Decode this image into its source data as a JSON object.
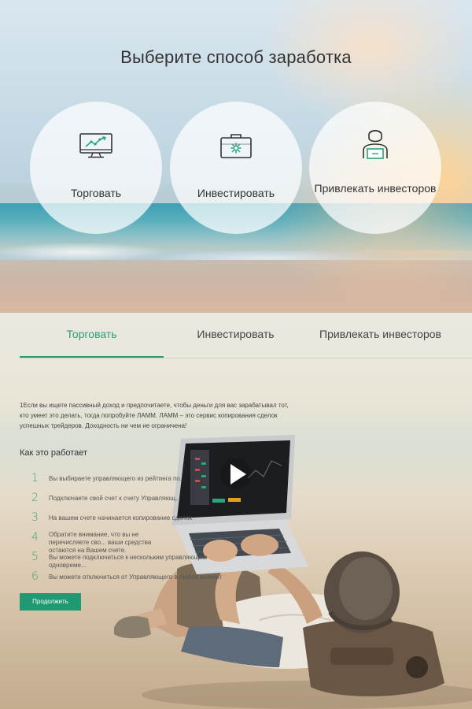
{
  "hero": {
    "title": "Выберите способ заработка",
    "options": [
      {
        "label": "Торговать",
        "icon": "monitor-chart-icon"
      },
      {
        "label": "Инвестировать",
        "icon": "briefcase-icon"
      },
      {
        "label": "Привлекать инвесторов",
        "icon": "person-presenter-icon"
      }
    ]
  },
  "tabs": [
    {
      "label": "Торговать",
      "active": true
    },
    {
      "label": "Инвестировать",
      "active": false
    },
    {
      "label": "Привлекать инвесторов",
      "active": false
    }
  ],
  "content": {
    "intro": "1Если вы ищете пассивный доход и предпочитаете, чтобы деньги для вас зарабатывал тот, кто умеет это делать, тогда попробуйте ЛАММ. ЛАММ – это сервис копирования сделок успешных трейдеров. Доходность ни чем не ограничена!",
    "how_title": "Как это работает",
    "steps": [
      {
        "num": "1",
        "text": "Вы выбираете управляющего из рейтинга по..."
      },
      {
        "num": "2",
        "text": "Подключаете свой счет к счету Управляющ..."
      },
      {
        "num": "3",
        "text": "На вашем счете начинается копирование сделок"
      },
      {
        "num": "4",
        "text": "Обратите внимание, что вы не перечисляете сво... ваши средства остаются на Вашем счете."
      },
      {
        "num": "5",
        "text": "Вы можете подключиться к нескольким управляющим одновреме..."
      },
      {
        "num": "6",
        "text": "Вы можете отключиться от Управляющего в любой момент"
      }
    ],
    "continue_label": "Продолжить"
  },
  "colors": {
    "accent": "#27a074",
    "button": "#1f9971"
  }
}
